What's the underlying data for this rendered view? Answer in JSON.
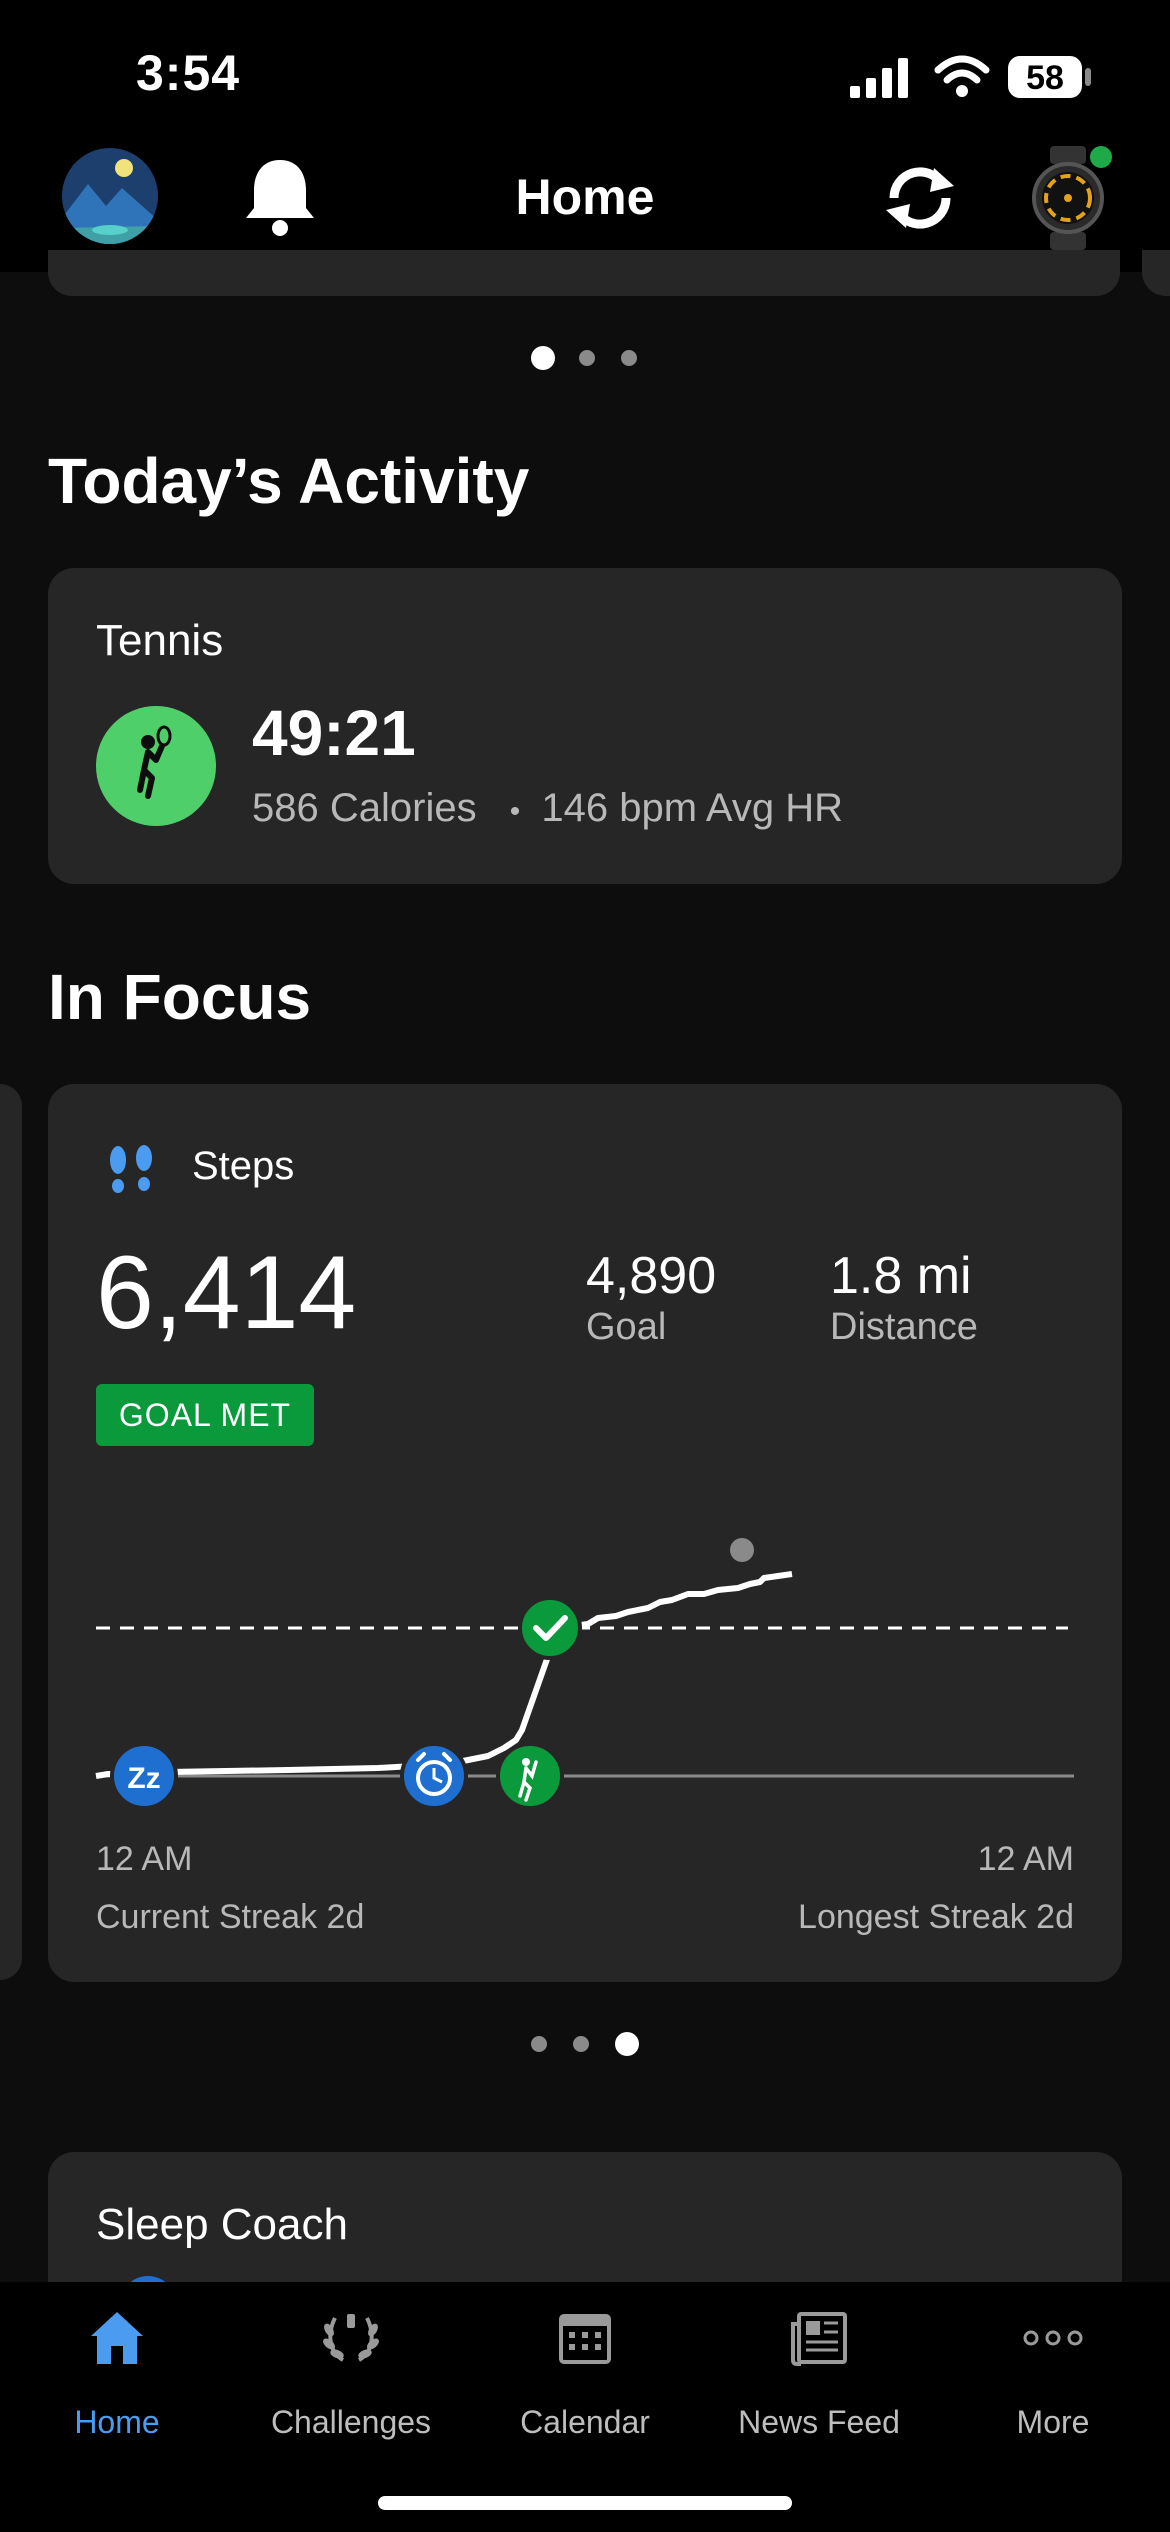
{
  "status_bar": {
    "time": "3:54",
    "battery": "58"
  },
  "header": {
    "title": "Home"
  },
  "carousel_top": {
    "pages": 3,
    "active": 0
  },
  "todays_activity": {
    "title": "Today’s Activity",
    "activity": {
      "name": "Tennis",
      "duration": "49:21",
      "calories": "586 Calories",
      "separator": "•",
      "avg_hr": "146 bpm Avg HR"
    }
  },
  "in_focus": {
    "title": "In Focus",
    "steps": {
      "label": "Steps",
      "value": "6,414",
      "goal_value": "4,890",
      "goal_label": "Goal",
      "distance_value": "1.8 mi",
      "distance_label": "Distance",
      "badge": "GOAL MET",
      "axis_start": "12 AM",
      "axis_end": "12 AM",
      "current_streak": "Current Streak 2d",
      "longest_streak": "Longest Streak 2d"
    },
    "carousel": {
      "pages": 3,
      "active": 2
    }
  },
  "sleep_coach": {
    "title": "Sleep Coach"
  },
  "tab_bar": {
    "items": [
      {
        "label": "Home",
        "icon": "home-icon",
        "active": true
      },
      {
        "label": "Challenges",
        "icon": "laurel-icon",
        "active": false
      },
      {
        "label": "Calendar",
        "icon": "calendar-icon",
        "active": false
      },
      {
        "label": "News Feed",
        "icon": "newspaper-icon",
        "active": false
      },
      {
        "label": "More",
        "icon": "more-dots-icon",
        "active": false
      }
    ]
  },
  "colors": {
    "accent_blue": "#4b9cf0",
    "goal_green": "#0a9a3c",
    "tennis_green": "#4fcf6a",
    "card_bg": "#262626"
  }
}
